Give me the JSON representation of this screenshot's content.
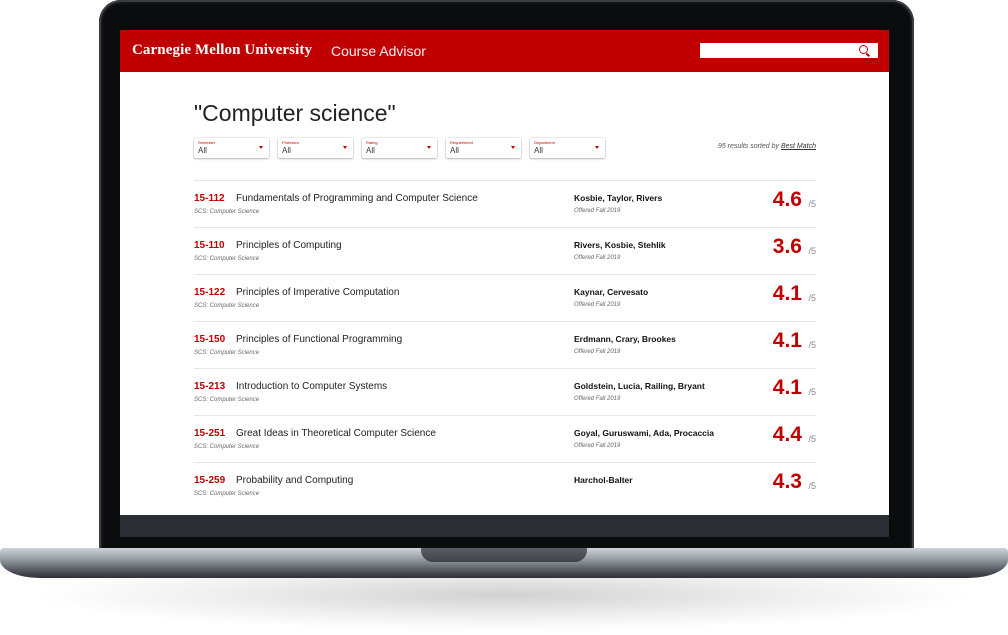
{
  "header": {
    "brand": "Carnegie Mellon University",
    "app_name": "Course Advisor",
    "search_placeholder": ""
  },
  "query_title": "\"Computer science\"",
  "filters": [
    {
      "label": "Semester",
      "value": "All"
    },
    {
      "label": "Professor",
      "value": "All"
    },
    {
      "label": "Rating",
      "value": "All"
    },
    {
      "label": "Requirement",
      "value": "All"
    },
    {
      "label": "Department",
      "value": "All"
    }
  ],
  "results": {
    "prefix": "95 results sorted by",
    "sort": "Best Match"
  },
  "courses": [
    {
      "code": "15-112",
      "name": "Fundamentals of Programming and Computer Science",
      "dept": "SCS: Computer Science",
      "professors": "Kosbie, Taylor, Rivers",
      "offered": "Offered Fall 2019",
      "rating": "4.6",
      "scale": "/5"
    },
    {
      "code": "15-110",
      "name": "Principles of Computing",
      "dept": "SCS: Computer Science",
      "professors": "Rivers, Kosbie, Stehlik",
      "offered": "Offered Fall 2019",
      "rating": "3.6",
      "scale": "/5"
    },
    {
      "code": "15-122",
      "name": "Principles of Imperative Computation",
      "dept": "SCS: Computer Science",
      "professors": "Kaynar, Cervesato",
      "offered": "Offered Fall 2019",
      "rating": "4.1",
      "scale": "/5"
    },
    {
      "code": "15-150",
      "name": "Principles of Functional Programming",
      "dept": "SCS: Computer Science",
      "professors": "Erdmann, Crary, Brookes",
      "offered": "Offered Fall 2019",
      "rating": "4.1",
      "scale": "/5"
    },
    {
      "code": "15-213",
      "name": "Introduction to Computer Systems",
      "dept": "SCS: Computer Science",
      "professors": "Goldstein, Lucia, Railing, Bryant",
      "offered": "Offered Fall 2019",
      "rating": "4.1",
      "scale": "/5"
    },
    {
      "code": "15-251",
      "name": "Great Ideas in Theoretical Computer Science",
      "dept": "SCS: Computer Science",
      "professors": "Goyal, Guruswami, Ada, Procaccia",
      "offered": "Offered Fall 2019",
      "rating": "4.4",
      "scale": "/5"
    },
    {
      "code": "15-259",
      "name": "Probability and Computing",
      "dept": "SCS: Computer Science",
      "professors": "Harchol-Balter",
      "offered": "",
      "rating": "4.3",
      "scale": "/5"
    }
  ],
  "colors": {
    "brand_red": "#c00000",
    "text_dark": "#222222"
  }
}
